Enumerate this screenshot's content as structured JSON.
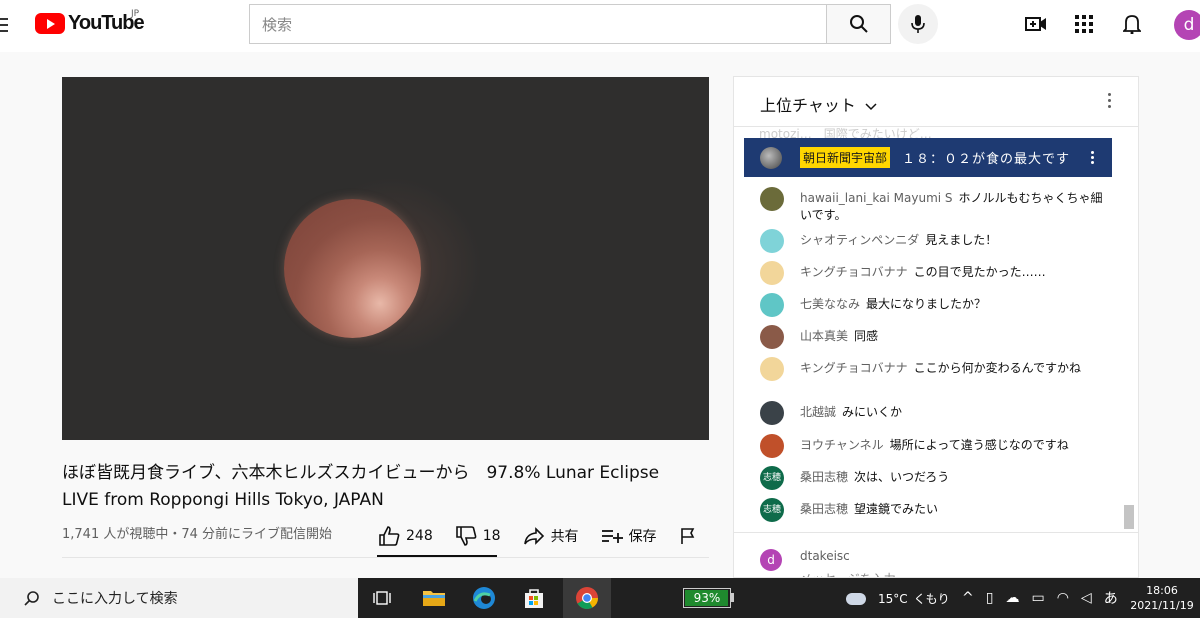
{
  "header": {
    "logo_text": "YouTube",
    "region": "JP",
    "search_placeholder": "検索",
    "avatar_letter": "d"
  },
  "video": {
    "title_line1": "ほぼ皆既月食ライブ、六本木ヒルズスカイビューから　97.8% Lunar Eclipse",
    "title_line2": "LIVE from Roppongi Hills Tokyo, JAPAN",
    "meta": "1,741 人が視聴中・74 分前にライブ配信開始",
    "likes": "248",
    "dislikes": "18",
    "share_label": "共有",
    "save_label": "保存"
  },
  "chat": {
    "title": "上位チャット",
    "ghost_text": "motozi…　国際でみたいけど…　",
    "pinned": {
      "badge": "朝日新聞宇宙部",
      "message": "１８：０２が食の最大です"
    },
    "messages": [
      {
        "name": "hawaii_lani_kai Mayumi S",
        "text": "ホノルルもむちゃくちゃ細いです。",
        "avatar_color": "#6b6b3a",
        "avatar_text": ""
      },
      {
        "name": "シャオティンペンニダ",
        "text": "見えました！",
        "avatar_color": "#7fd3d8",
        "avatar_text": ""
      },
      {
        "name": "キングチョコバナナ",
        "text": "この目で見たかった……",
        "avatar_color": "#f2d69a",
        "avatar_text": ""
      },
      {
        "name": "七美ななみ",
        "text": "最大になりましたか？",
        "avatar_color": "#5fc6c6",
        "avatar_text": ""
      },
      {
        "name": "山本真美",
        "text": "同感",
        "avatar_color": "#8a5a48",
        "avatar_text": ""
      },
      {
        "name": "キングチョコバナナ",
        "text": "ここから何か変わるんですかね",
        "avatar_color": "#f2d69a",
        "avatar_text": ""
      },
      {
        "name": "北越誠",
        "text": "みにいくか",
        "avatar_color": "#3a4248",
        "avatar_text": ""
      },
      {
        "name": "ヨウチャンネル",
        "text": "場所によって違う感じなのですね",
        "avatar_color": "#c0502a",
        "avatar_text": ""
      },
      {
        "name": "桑田志穂",
        "text": "次は、いつだろう",
        "avatar_color": "#0e6b4a",
        "avatar_text": "志穂"
      },
      {
        "name": "桑田志穂",
        "text": "望遠鏡でみたい",
        "avatar_color": "#0e6b4a",
        "avatar_text": "志穂"
      }
    ],
    "input_user": "dtakeisc",
    "input_placeholder": "メッセージを入力..."
  },
  "taskbar": {
    "search_text": "ここに入力して検索",
    "battery": "93%",
    "battery_level": 0.93,
    "temperature": "15°C",
    "weather_text": "くもり",
    "ime": "あ",
    "time": "18:06",
    "date": "2021/11/19"
  },
  "colors": {
    "brand_red": "#ff0000",
    "pinned_bg": "#1e3a72",
    "badge_yellow": "#ffd600"
  }
}
